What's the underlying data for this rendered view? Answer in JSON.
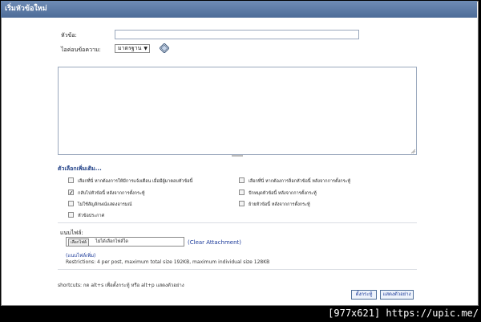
{
  "window": {
    "title": "เริ่มหัวข้อใหม่"
  },
  "form": {
    "subject_label": "หัวข้อ:",
    "subject_value": "",
    "icon_label": "ไอค่อนข้อความ:",
    "icon_select_value": "มาตรฐาน",
    "message_value": ""
  },
  "options": {
    "title": "ตัวเลือกเพิ่มเติม...",
    "items": [
      {
        "label": "เลือกที่นี่ หากต้องการให้มีการแจ้งเตือน เมื่อมีผู้มาตอบหัวข้อนี้",
        "checked": false
      },
      {
        "label": "เลือกที่นี่ หากต้องการล็อกหัวข้อนี้ หลังจากการตั้งกระทู้",
        "checked": false
      },
      {
        "label": "กลับไปหัวข้อนี้ หลังจากการตั้งกระทู้",
        "checked": true
      },
      {
        "label": "ปักหมุดหัวข้อนี้ หลังจากการตั้งกระทู้",
        "checked": false
      },
      {
        "label": "ไม่ใช้สัญลักษณ์แสดงอารมณ์",
        "checked": false
      },
      {
        "label": "ย้ายหัวข้อนี้ หลังจากการตั้งกระทู้",
        "checked": false
      },
      {
        "label": "หัวข้อประกาศ",
        "checked": false
      }
    ]
  },
  "attachment": {
    "label": "แนบไฟล์:",
    "browse_label": "เลือกไฟล์",
    "file_text": "ไม่ได้เลือกไฟล์ใด",
    "clear_label": "(Clear Attachment)",
    "more_label": "(แนบไฟล์เพิ่ม)",
    "restrictions": "Restrictions: 4 per post, maximum total size 192KB, maximum individual size 128KB"
  },
  "footer": {
    "shortcuts": "shortcuts: กด alt+s เพื่อตั้งกระทู้ หรือ alt+p แสดงตัวอย่าง",
    "submit_label": "ตั้งกระทู้",
    "preview_label": "แสดงตัวอย่าง"
  },
  "watermark": "[977x621] https://upic.me/"
}
